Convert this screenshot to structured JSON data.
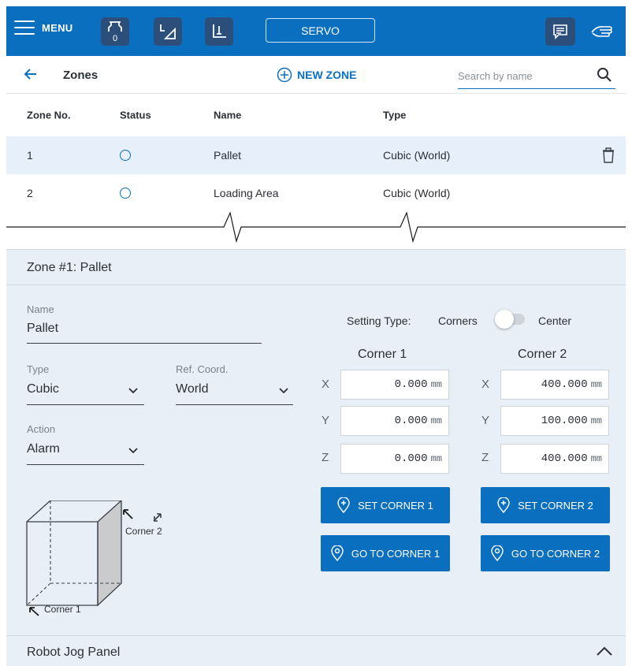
{
  "topbar": {
    "menu_label": "MENU",
    "tool_count": "0",
    "servo_label": "SERVO"
  },
  "header": {
    "title": "Zones",
    "new_zone_label": "NEW ZONE",
    "search_placeholder": "Search by name"
  },
  "table": {
    "columns": [
      "Zone No.",
      "Status",
      "Name",
      "Type"
    ],
    "rows": [
      {
        "no": "1",
        "name": "Pallet",
        "type": "Cubic (World)",
        "selected": true
      },
      {
        "no": "2",
        "name": "Loading Area",
        "type": "Cubic (World)",
        "selected": false
      }
    ]
  },
  "zone": {
    "title": "Zone #1: Pallet",
    "name_label": "Name",
    "name_value": "Pallet",
    "type_label": "Type",
    "type_value": "Cubic",
    "ref_label": "Ref. Coord.",
    "ref_value": "World",
    "action_label": "Action",
    "action_value": "Alarm",
    "setting_type_label": "Setting Type:",
    "corners_label": "Corners",
    "center_label": "Center",
    "toggle_state": "Corners",
    "corner1": {
      "heading": "Corner 1",
      "x": "0.000",
      "y": "0.000",
      "z": "0.000",
      "set_label": "SET CORNER 1",
      "go_label": "GO TO CORNER 1"
    },
    "corner2": {
      "heading": "Corner 2",
      "x": "400.000",
      "y": "100.000",
      "z": "400.000",
      "set_label": "SET CORNER 2",
      "go_label": "GO TO CORNER 2"
    },
    "unit": "mm",
    "axes": [
      "X",
      "Y",
      "Z"
    ],
    "diagram_corner1": "Corner 1",
    "diagram_corner2": "Corner 2"
  },
  "jog_panel": {
    "title": "Robot Jog Panel"
  },
  "colors": {
    "accent": "#0b6fc0",
    "panel_bg": "#e8eff6",
    "selected_row": "#e7f0fa",
    "icon_bg": "#2b4f7a"
  }
}
